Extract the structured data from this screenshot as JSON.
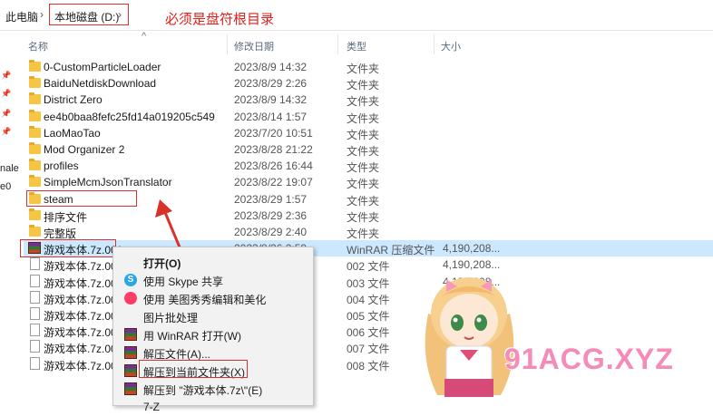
{
  "breadcrumb": {
    "items": [
      "此电脑",
      "本地磁盘 (D:)"
    ],
    "separator": "›",
    "annotation": "必须是盘符根目录"
  },
  "sidebar": {
    "partial_labels": [
      "nale",
      "e0"
    ]
  },
  "columns": {
    "name": "名称",
    "date": "修改日期",
    "type": "类型",
    "size": "大小"
  },
  "files": [
    {
      "name": "0-CustomParticleLoader",
      "date": "2023/8/9 14:32",
      "type": "文件夹",
      "size": "",
      "icon": "folder"
    },
    {
      "name": "BaiduNetdiskDownload",
      "date": "2023/8/29 2:26",
      "type": "文件夹",
      "size": "",
      "icon": "folder"
    },
    {
      "name": "District Zero",
      "date": "2023/8/9 14:32",
      "type": "文件夹",
      "size": "",
      "icon": "folder"
    },
    {
      "name": "ee4b0baa8fefc25fd14a019205c549",
      "date": "2023/8/14 1:57",
      "type": "文件夹",
      "size": "",
      "icon": "folder"
    },
    {
      "name": "LaoMaoTao",
      "date": "2023/7/20 10:51",
      "type": "文件夹",
      "size": "",
      "icon": "folder"
    },
    {
      "name": "Mod Organizer 2",
      "date": "2023/8/28 21:22",
      "type": "文件夹",
      "size": "",
      "icon": "folder"
    },
    {
      "name": "profiles",
      "date": "2023/8/26 16:44",
      "type": "文件夹",
      "size": "",
      "icon": "folder"
    },
    {
      "name": "SimpleMcmJsonTranslator",
      "date": "2023/8/22 19:07",
      "type": "文件夹",
      "size": "",
      "icon": "folder"
    },
    {
      "name": "steam",
      "date": "2023/8/29 1:57",
      "type": "文件夹",
      "size": "",
      "icon": "folder"
    },
    {
      "name": "排序文件",
      "date": "2023/8/29 2:36",
      "type": "文件夹",
      "size": "",
      "icon": "folder"
    },
    {
      "name": "完整版",
      "date": "2023/8/29 2:40",
      "type": "文件夹",
      "size": "",
      "icon": "folder"
    },
    {
      "name": "游戏本体.7z.001",
      "date": "2023/8/26 2:59",
      "type": "WinRAR 压缩文件",
      "size": "4,190,208...",
      "icon": "rar"
    },
    {
      "name": "游戏本体.7z.002",
      "date": "",
      "type": "002 文件",
      "size": "4,190,208...",
      "icon": "file"
    },
    {
      "name": "游戏本体.7z.003",
      "date": "",
      "type": "003 文件",
      "size": "4,190,208...",
      "icon": "file"
    },
    {
      "name": "游戏本体.7z.004",
      "date": "",
      "type": "004 文件",
      "size": "",
      "icon": "file"
    },
    {
      "name": "游戏本体.7z.005",
      "date": "",
      "type": "005 文件",
      "size": "",
      "icon": "file"
    },
    {
      "name": "游戏本体.7z.006",
      "date": "",
      "type": "006 文件",
      "size": "",
      "icon": "file"
    },
    {
      "name": "游戏本体.7z.007",
      "date": "",
      "type": "007 文件",
      "size": "",
      "icon": "file"
    },
    {
      "name": "游戏本体.7z.008",
      "date": "",
      "type": "008 文件",
      "size": "",
      "icon": "file"
    }
  ],
  "context_menu": {
    "items": [
      {
        "label": "打开(O)",
        "icon": "none",
        "bold": true
      },
      {
        "label": "使用 Skype 共享",
        "icon": "skype-icon"
      },
      {
        "label": "使用 美图秀秀编辑和美化",
        "icon": "meitu-icon"
      },
      {
        "label": "图片批处理",
        "icon": "none"
      },
      {
        "label": "用 WinRAR 打开(W)",
        "icon": "winrar-icon"
      },
      {
        "label": "解压文件(A)...",
        "icon": "winrar-icon"
      },
      {
        "label": "解压到当前文件夹(X)",
        "icon": "winrar-icon"
      },
      {
        "label": "解压到 \"游戏本体.7z\\\"(E)",
        "icon": "winrar-icon"
      },
      {
        "label": "7-Z",
        "icon": "none"
      }
    ]
  },
  "watermark": {
    "text": "91ACG.XYZ"
  },
  "colors": {
    "annotation_red": "#e0211b",
    "selection_blue": "#cce8ff",
    "folder_yellow": "#f6c543",
    "watermark_pink": "#f48bb8"
  }
}
